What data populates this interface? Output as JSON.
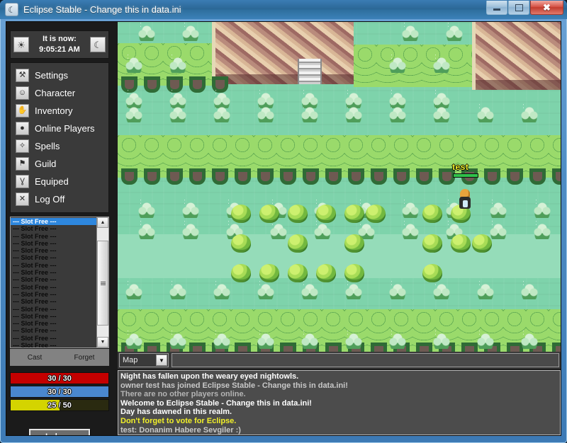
{
  "window": {
    "title": "Eclipse Stable - Change this in data.ini",
    "app_icon": "moon-icon",
    "buttons": {
      "minimize": "minimize",
      "maximize": "maximize",
      "close": "close"
    }
  },
  "clock": {
    "label": "It is now:",
    "time": "9:05:21 AM",
    "sun_icon": "sun-icon",
    "moon_icon": "moon-icon"
  },
  "menu": {
    "items": [
      {
        "label": "Settings",
        "icon": "wrench-icon",
        "glyph": "⚒"
      },
      {
        "label": "Character",
        "icon": "smiley-face-icon",
        "glyph": "☺"
      },
      {
        "label": "Inventory",
        "icon": "hand-icon",
        "glyph": "✋"
      },
      {
        "label": "Online Players",
        "icon": "speech-bubble-icon",
        "glyph": "●"
      },
      {
        "label": "Spells",
        "icon": "magic-wand-icon",
        "glyph": "✧"
      },
      {
        "label": "Guild",
        "icon": "flag-icon",
        "glyph": "⚑"
      },
      {
        "label": "Equiped",
        "icon": "person-icon",
        "glyph": "Ɣ"
      },
      {
        "label": "Log Off",
        "icon": "close-x-icon",
        "glyph": "✕"
      }
    ]
  },
  "spells": {
    "slot_label": "--- Slot Free ---",
    "slot_count": 18,
    "selected_index": 0,
    "cast_label": "Cast",
    "forget_label": "Forget",
    "scrollbar": {
      "up": "▲",
      "down": "▼"
    }
  },
  "stats": {
    "hp": {
      "text": "30 / 30",
      "current": 30,
      "max": 30,
      "color": "#c40000"
    },
    "mp": {
      "text": "30 / 30",
      "current": 30,
      "max": 30,
      "color": "#4a87cf"
    },
    "exp": {
      "text": "25 / 50",
      "current": 25,
      "max": 50,
      "color": "#d4d400"
    }
  },
  "inbox": {
    "label": "Inbox"
  },
  "chat": {
    "channel": "Map",
    "chevron": "▼",
    "input_value": "",
    "input_placeholder": "",
    "lines": [
      {
        "text": "Night has fallen upon the weary eyed nightowls.",
        "color": "#ffffff"
      },
      {
        "text": "owner test has joined Eclipse Stable - Change this in data.ini!",
        "color": "#c8c8c8"
      },
      {
        "text": "There are no other players online.",
        "color": "#b4b4b4"
      },
      {
        "text": "Welcome to Eclipse Stable - Change this in data.ini!",
        "color": "#ffffff"
      },
      {
        "text": "Day has dawned in this realm.",
        "color": "#ffffff"
      },
      {
        "text": "Don't forget to vote for Eclipse.",
        "color": "#f2f02a"
      },
      {
        "text": "test: Donanim Habere Sevgiler :)",
        "color": "#c8c8c8"
      }
    ]
  },
  "game": {
    "player_name": "test",
    "player_hp_percent": 100,
    "player_name_color": "#f2f02a",
    "player_hp_color": "#2fc24a",
    "map_colors": {
      "grass": "#7ed3ab",
      "path": "#95dcb9",
      "tree_dark": "#46913f",
      "tree_light": "#9ada6b",
      "cliff_light": "#e8cfae",
      "cliff_dark": "#9e6a63"
    }
  }
}
